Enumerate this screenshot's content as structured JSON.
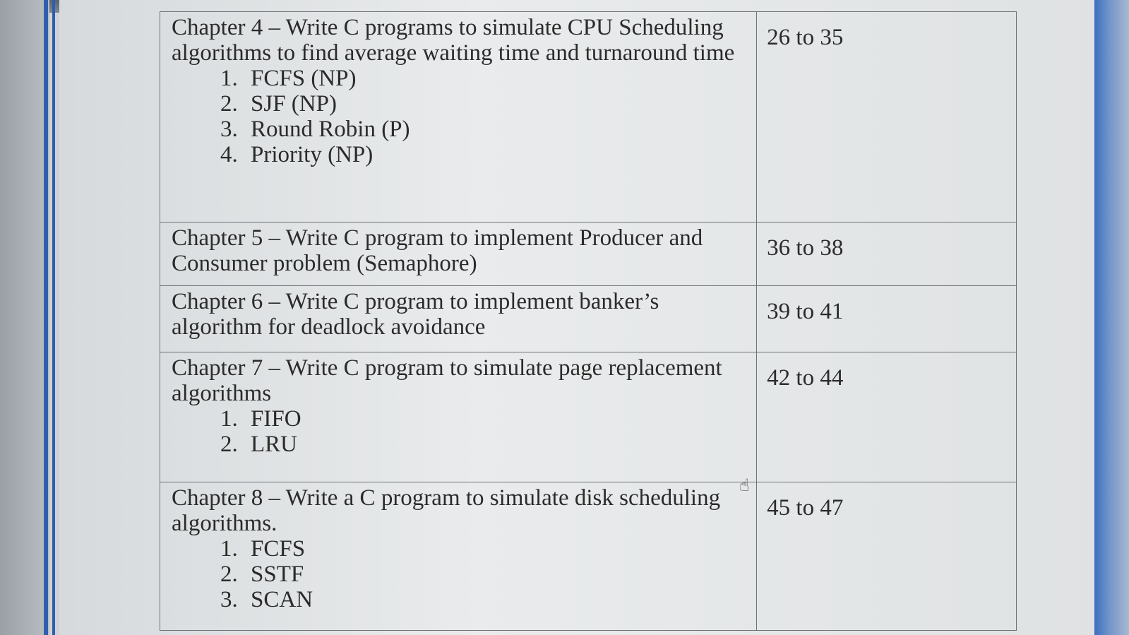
{
  "chapters": [
    {
      "heading": "Chapter 4 – Write C programs to simulate CPU Scheduling algorithms to find average waiting time and turnaround time",
      "items": [
        "FCFS (NP)",
        "SJF (NP)",
        "Round Robin (P)",
        "Priority (NP)"
      ],
      "pages": "26 to 35"
    },
    {
      "heading": "Chapter 5 – Write C program to implement Producer and Consumer problem (Semaphore)",
      "items": [],
      "pages": "36 to 38"
    },
    {
      "heading": "Chapter 6 – Write C program to implement banker’s algorithm for deadlock avoidance",
      "items": [],
      "pages": "39 to 41"
    },
    {
      "heading": "Chapter 7 – Write C program to simulate page replacement algorithms",
      "items": [
        "FIFO",
        "LRU"
      ],
      "pages": "42 to 44"
    },
    {
      "heading": "Chapter 8 – Write a C program to simulate disk scheduling algorithms.",
      "items": [
        "FCFS",
        "SSTF",
        "SCAN"
      ],
      "pages": "45 to 47"
    }
  ],
  "cursor": {
    "icon": "hand-cursor-icon"
  },
  "colors": {
    "frame_blue": "#2d5fae",
    "text": "#2b2b2b",
    "grid": "#6f7377"
  }
}
